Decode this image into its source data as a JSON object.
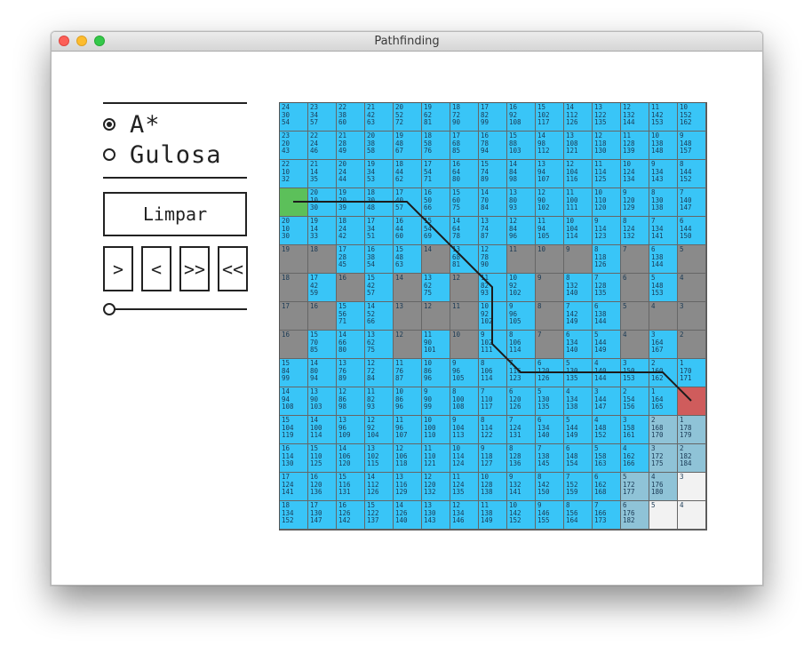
{
  "window": {
    "title": "Pathfinding"
  },
  "controls": {
    "algorithms": [
      {
        "label": "A*",
        "selected": true
      },
      {
        "label": "Gulosa",
        "selected": false
      }
    ],
    "clear_label": "Limpar",
    "step_buttons": [
      ">",
      "<",
      ">>",
      "<<"
    ],
    "speed": 0
  },
  "colors": {
    "open": "#39c5f7",
    "wall": "#8a8a8a",
    "closed": "#8fc3d7",
    "empty": "#f2f2f2",
    "start": "#5cc05a",
    "goal": "#cf5c5c",
    "path": "#1c1c1c"
  },
  "grid": {
    "rows": [
      [
        [
          "o",
          "24\n30\n54"
        ],
        [
          "o",
          "23\n34\n57"
        ],
        [
          "o",
          "22\n38\n60"
        ],
        [
          "o",
          "21\n42\n63"
        ],
        [
          "o",
          "20\n52\n72"
        ],
        [
          "o",
          "19\n62\n81"
        ],
        [
          "o",
          "18\n72\n90"
        ],
        [
          "o",
          "17\n82\n99"
        ],
        [
          "o",
          "16\n92\n108"
        ],
        [
          "o",
          "15\n102\n117"
        ],
        [
          "o",
          "14\n112\n126"
        ],
        [
          "o",
          "13\n122\n135"
        ],
        [
          "o",
          "12\n132\n144"
        ],
        [
          "o",
          "11\n142\n153"
        ],
        [
          "o",
          "10\n152\n162"
        ]
      ],
      [
        [
          "o",
          "23\n20\n43"
        ],
        [
          "o",
          "22\n24\n46"
        ],
        [
          "o",
          "21\n28\n49"
        ],
        [
          "o",
          "20\n38\n58"
        ],
        [
          "o",
          "19\n48\n67"
        ],
        [
          "o",
          "18\n58\n76"
        ],
        [
          "o",
          "17\n68\n85"
        ],
        [
          "o",
          "16\n78\n94"
        ],
        [
          "o",
          "15\n88\n103"
        ],
        [
          "o",
          "14\n98\n112"
        ],
        [
          "o",
          "13\n108\n121"
        ],
        [
          "o",
          "12\n118\n130"
        ],
        [
          "o",
          "11\n128\n139"
        ],
        [
          "o",
          "10\n138\n148"
        ],
        [
          "o",
          "9\n148\n157"
        ]
      ],
      [
        [
          "o",
          "22\n10\n32"
        ],
        [
          "o",
          "21\n14\n35"
        ],
        [
          "o",
          "20\n24\n44"
        ],
        [
          "o",
          "19\n34\n53"
        ],
        [
          "o",
          "18\n44\n62"
        ],
        [
          "o",
          "17\n54\n71"
        ],
        [
          "o",
          "16\n64\n80"
        ],
        [
          "o",
          "15\n74\n89"
        ],
        [
          "o",
          "14\n84\n98"
        ],
        [
          "o",
          "13\n94\n107"
        ],
        [
          "o",
          "12\n104\n116"
        ],
        [
          "o",
          "11\n114\n125"
        ],
        [
          "o",
          "10\n124\n134"
        ],
        [
          "o",
          "9\n134\n143"
        ],
        [
          "o",
          "8\n144\n152"
        ]
      ],
      [
        [
          "s",
          ""
        ],
        [
          "o",
          "20\n10\n30"
        ],
        [
          "o",
          "19\n20\n39"
        ],
        [
          "o",
          "18\n30\n48"
        ],
        [
          "o",
          "17\n40\n57"
        ],
        [
          "o",
          "16\n50\n66"
        ],
        [
          "o",
          "15\n60\n75"
        ],
        [
          "o",
          "14\n70\n84"
        ],
        [
          "o",
          "13\n80\n93"
        ],
        [
          "o",
          "12\n90\n102"
        ],
        [
          "o",
          "11\n100\n111"
        ],
        [
          "o",
          "10\n110\n120"
        ],
        [
          "o",
          "9\n120\n129"
        ],
        [
          "o",
          "8\n130\n138"
        ],
        [
          "o",
          "7\n140\n147"
        ]
      ],
      [
        [
          "o",
          "20\n10\n30"
        ],
        [
          "o",
          "19\n14\n33"
        ],
        [
          "o",
          "18\n24\n42"
        ],
        [
          "o",
          "17\n34\n51"
        ],
        [
          "o",
          "16\n44\n60"
        ],
        [
          "o",
          "15\n54\n69"
        ],
        [
          "o",
          "14\n64\n78"
        ],
        [
          "o",
          "13\n74\n87"
        ],
        [
          "o",
          "12\n84\n96"
        ],
        [
          "o",
          "11\n94\n105"
        ],
        [
          "o",
          "10\n104\n114"
        ],
        [
          "o",
          "9\n114\n123"
        ],
        [
          "o",
          "8\n124\n132"
        ],
        [
          "o",
          "7\n134\n141"
        ],
        [
          "o",
          "6\n144\n150"
        ]
      ],
      [
        [
          "w",
          "19"
        ],
        [
          "w",
          "18"
        ],
        [
          "o",
          "17\n28\n45"
        ],
        [
          "o",
          "16\n38\n54"
        ],
        [
          "o",
          "15\n48\n63"
        ],
        [
          "w",
          "14"
        ],
        [
          "o",
          "13\n68\n81"
        ],
        [
          "o",
          "12\n78\n90"
        ],
        [
          "w",
          "11"
        ],
        [
          "w",
          "10"
        ],
        [
          "w",
          "9"
        ],
        [
          "o",
          "8\n118\n126"
        ],
        [
          "w",
          "7"
        ],
        [
          "o",
          "6\n138\n144"
        ],
        [
          "w",
          "5"
        ]
      ],
      [
        [
          "w",
          "18"
        ],
        [
          "o",
          "17\n42\n59"
        ],
        [
          "w",
          "16"
        ],
        [
          "o",
          "15\n42\n57"
        ],
        [
          "w",
          "14"
        ],
        [
          "o",
          "13\n62\n75"
        ],
        [
          "w",
          "12"
        ],
        [
          "o",
          "11\n82\n93"
        ],
        [
          "o",
          "10\n92\n102"
        ],
        [
          "w",
          "9"
        ],
        [
          "o",
          "8\n132\n140"
        ],
        [
          "o",
          "7\n128\n135"
        ],
        [
          "w",
          "6"
        ],
        [
          "o",
          "5\n148\n153"
        ],
        [
          "w",
          "4"
        ]
      ],
      [
        [
          "w",
          "17"
        ],
        [
          "w",
          "16"
        ],
        [
          "o",
          "15\n56\n71"
        ],
        [
          "o",
          "14\n52\n66"
        ],
        [
          "w",
          "13"
        ],
        [
          "w",
          "12"
        ],
        [
          "w",
          "11"
        ],
        [
          "o",
          "10\n92\n102"
        ],
        [
          "o",
          "9\n96\n105"
        ],
        [
          "w",
          "8"
        ],
        [
          "o",
          "7\n142\n149"
        ],
        [
          "o",
          "6\n138\n144"
        ],
        [
          "w",
          "5"
        ],
        [
          "w",
          "4"
        ],
        [
          "w",
          "3"
        ]
      ],
      [
        [
          "w",
          "16"
        ],
        [
          "o",
          "15\n70\n85"
        ],
        [
          "o",
          "14\n66\n80"
        ],
        [
          "o",
          "13\n62\n75"
        ],
        [
          "w",
          "12"
        ],
        [
          "o",
          "11\n90\n101"
        ],
        [
          "w",
          "10"
        ],
        [
          "o",
          "9\n102\n111"
        ],
        [
          "o",
          "8\n106\n114"
        ],
        [
          "w",
          "7"
        ],
        [
          "o",
          "6\n134\n140"
        ],
        [
          "o",
          "5\n144\n149"
        ],
        [
          "w",
          "4"
        ],
        [
          "o",
          "3\n164\n167"
        ],
        [
          "w",
          "2"
        ]
      ],
      [
        [
          "o",
          "15\n84\n99"
        ],
        [
          "o",
          "14\n80\n94"
        ],
        [
          "o",
          "13\n76\n89"
        ],
        [
          "o",
          "12\n72\n84"
        ],
        [
          "o",
          "11\n76\n87"
        ],
        [
          "o",
          "10\n86\n96"
        ],
        [
          "o",
          "9\n96\n105"
        ],
        [
          "o",
          "8\n106\n114"
        ],
        [
          "o",
          "7\n116\n123"
        ],
        [
          "o",
          "6\n120\n126"
        ],
        [
          "o",
          "5\n130\n135"
        ],
        [
          "o",
          "4\n140\n144"
        ],
        [
          "o",
          "3\n150\n153"
        ],
        [
          "o",
          "2\n160\n162"
        ],
        [
          "o",
          "1\n170\n171"
        ]
      ],
      [
        [
          "o",
          "14\n94\n108"
        ],
        [
          "o",
          "13\n90\n103"
        ],
        [
          "o",
          "12\n86\n98"
        ],
        [
          "o",
          "11\n82\n93"
        ],
        [
          "o",
          "10\n86\n96"
        ],
        [
          "o",
          "9\n90\n99"
        ],
        [
          "o",
          "8\n100\n108"
        ],
        [
          "o",
          "7\n110\n117"
        ],
        [
          "o",
          "6\n120\n126"
        ],
        [
          "o",
          "5\n130\n135"
        ],
        [
          "o",
          "4\n134\n138"
        ],
        [
          "o",
          "3\n144\n147"
        ],
        [
          "o",
          "2\n154\n156"
        ],
        [
          "o",
          "1\n164\n165"
        ],
        [
          "g",
          ""
        ]
      ],
      [
        [
          "o",
          "15\n104\n119"
        ],
        [
          "o",
          "14\n100\n114"
        ],
        [
          "o",
          "13\n96\n109"
        ],
        [
          "o",
          "12\n92\n104"
        ],
        [
          "o",
          "11\n96\n107"
        ],
        [
          "o",
          "10\n100\n110"
        ],
        [
          "o",
          "9\n104\n113"
        ],
        [
          "o",
          "8\n114\n122"
        ],
        [
          "o",
          "7\n124\n131"
        ],
        [
          "o",
          "6\n134\n140"
        ],
        [
          "o",
          "5\n144\n149"
        ],
        [
          "o",
          "4\n148\n152"
        ],
        [
          "o",
          "3\n158\n161"
        ],
        [
          "c",
          "2\n168\n170"
        ],
        [
          "c",
          "1\n178\n179"
        ]
      ],
      [
        [
          "o",
          "16\n114\n130"
        ],
        [
          "o",
          "15\n110\n125"
        ],
        [
          "o",
          "14\n106\n120"
        ],
        [
          "o",
          "13\n102\n115"
        ],
        [
          "o",
          "12\n106\n118"
        ],
        [
          "o",
          "11\n110\n121"
        ],
        [
          "o",
          "10\n114\n124"
        ],
        [
          "o",
          "9\n118\n127"
        ],
        [
          "o",
          "8\n128\n136"
        ],
        [
          "o",
          "7\n138\n145"
        ],
        [
          "o",
          "6\n148\n154"
        ],
        [
          "o",
          "5\n158\n163"
        ],
        [
          "o",
          "4\n162\n166"
        ],
        [
          "c",
          "3\n172\n175"
        ],
        [
          "c",
          "2\n182\n184"
        ]
      ],
      [
        [
          "o",
          "17\n124\n141"
        ],
        [
          "o",
          "16\n120\n136"
        ],
        [
          "o",
          "15\n116\n131"
        ],
        [
          "o",
          "14\n112\n126"
        ],
        [
          "o",
          "13\n116\n129"
        ],
        [
          "o",
          "12\n120\n132"
        ],
        [
          "o",
          "11\n124\n135"
        ],
        [
          "o",
          "10\n128\n138"
        ],
        [
          "o",
          "9\n132\n141"
        ],
        [
          "o",
          "8\n142\n150"
        ],
        [
          "o",
          "7\n152\n159"
        ],
        [
          "o",
          "6\n162\n168"
        ],
        [
          "c",
          "5\n172\n177"
        ],
        [
          "c",
          "4\n176\n180"
        ],
        [
          "e",
          "3"
        ]
      ],
      [
        [
          "o",
          "18\n134\n152"
        ],
        [
          "o",
          "17\n130\n147"
        ],
        [
          "o",
          "16\n126\n142"
        ],
        [
          "o",
          "15\n122\n137"
        ],
        [
          "o",
          "14\n126\n140"
        ],
        [
          "o",
          "13\n130\n143"
        ],
        [
          "o",
          "12\n134\n146"
        ],
        [
          "o",
          "11\n138\n149"
        ],
        [
          "o",
          "10\n142\n152"
        ],
        [
          "o",
          "9\n146\n155"
        ],
        [
          "o",
          "8\n156\n164"
        ],
        [
          "o",
          "7\n166\n173"
        ],
        [
          "c",
          "6\n176\n182"
        ],
        [
          "e",
          "5"
        ],
        [
          "e",
          "4"
        ]
      ]
    ],
    "path": [
      [
        0,
        3
      ],
      [
        1,
        3
      ],
      [
        2,
        3
      ],
      [
        3,
        3
      ],
      [
        4,
        3
      ],
      [
        5,
        4
      ],
      [
        6,
        5
      ],
      [
        7,
        6
      ],
      [
        7,
        7
      ],
      [
        7,
        8
      ],
      [
        8,
        9
      ],
      [
        9,
        9
      ],
      [
        10,
        9
      ],
      [
        11,
        9
      ],
      [
        12,
        9
      ],
      [
        13,
        9
      ],
      [
        14,
        10
      ]
    ]
  }
}
